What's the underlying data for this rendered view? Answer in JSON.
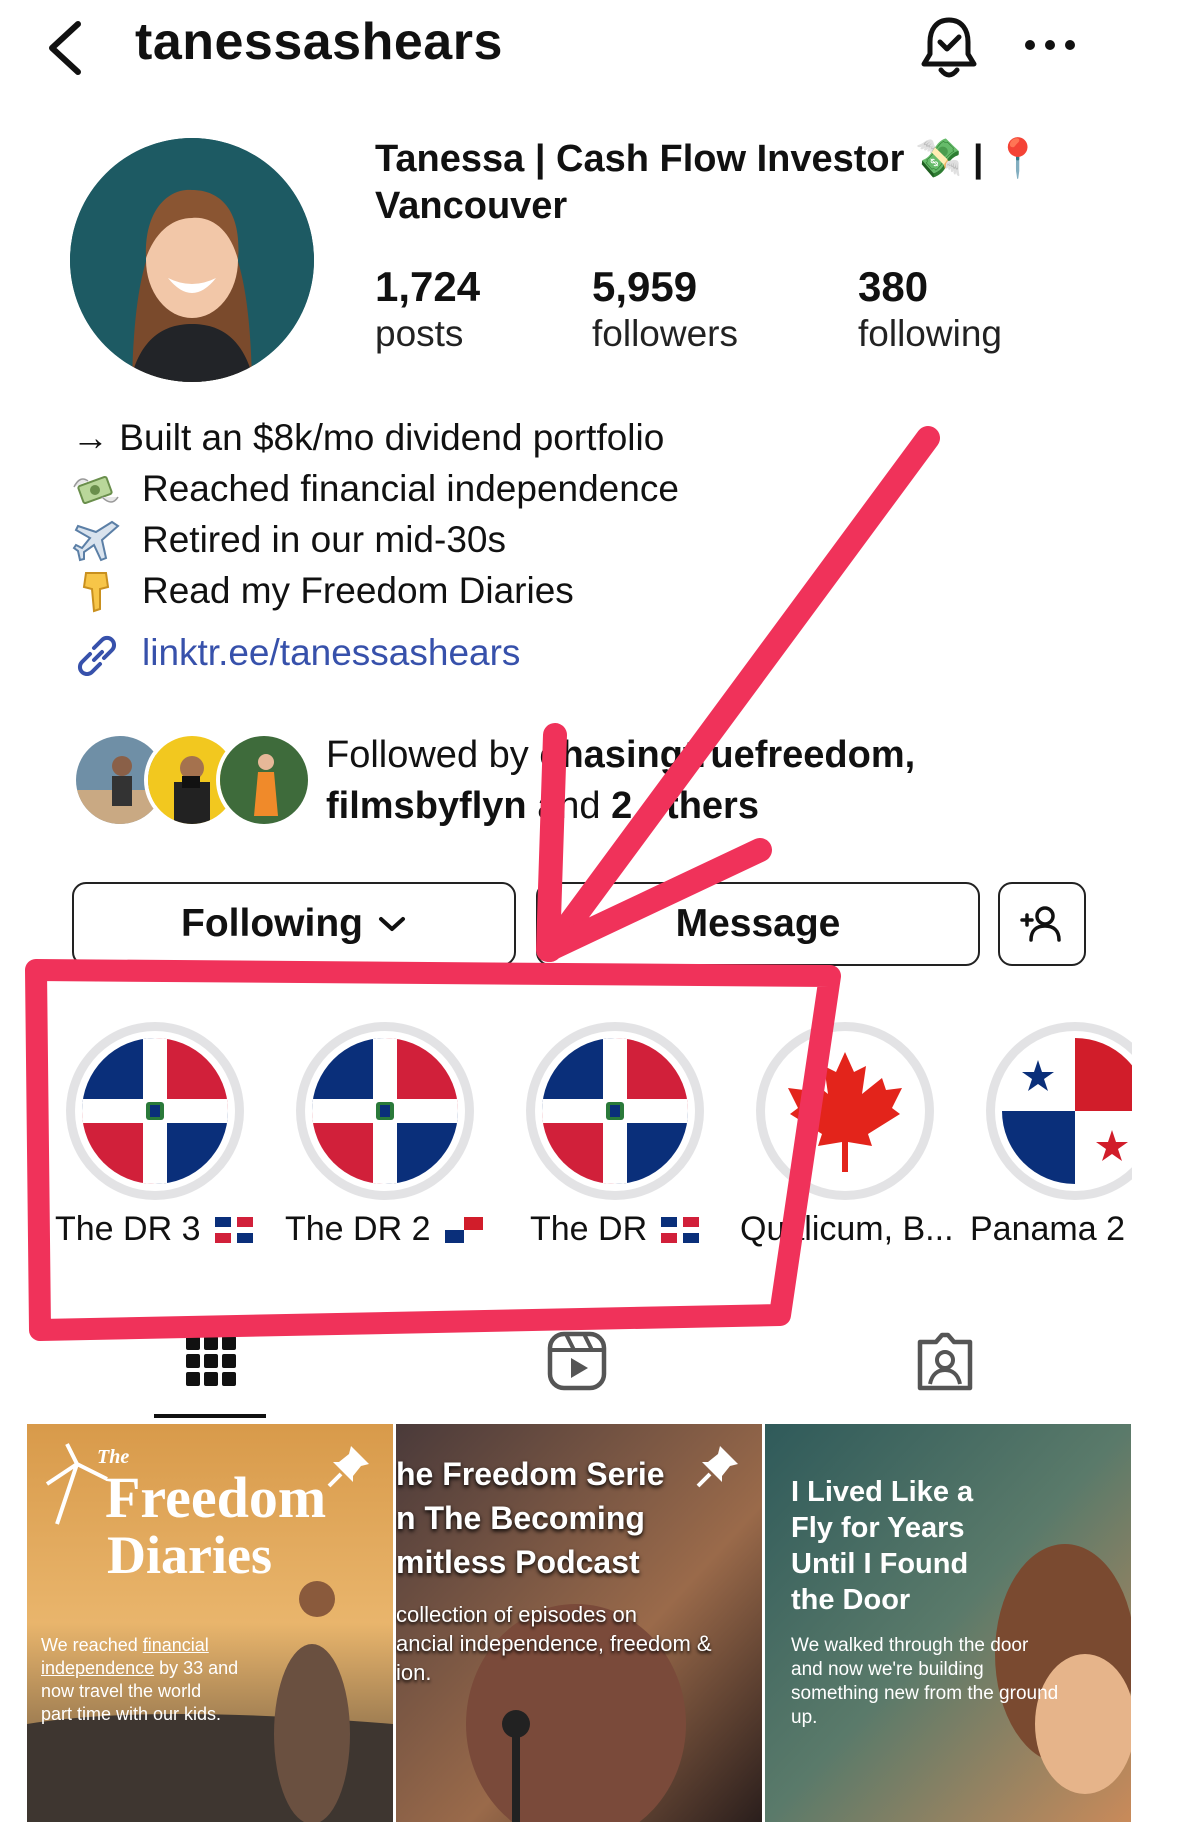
{
  "header": {
    "username": "tanessashears"
  },
  "profile": {
    "display_name": "Tanessa | Cash Flow Investor 💸 | 📍 Vancouver",
    "stats": [
      {
        "value": "1,724",
        "label": "posts"
      },
      {
        "value": "5,959",
        "label": "followers"
      },
      {
        "value": "380",
        "label": "following"
      }
    ],
    "bio": [
      {
        "icon": "arrow-right",
        "text": "→ Built an $8k/mo dividend portfolio"
      },
      {
        "icon": "money-with-wings-emoji",
        "text": "Reached financial independence"
      },
      {
        "icon": "airplane-emoji",
        "text": "Retired in our mid-30s"
      },
      {
        "icon": "pointing-down-emoji",
        "text": "Read my Freedom Diaries"
      }
    ],
    "link": "linktr.ee/tanessashears"
  },
  "followed_by": {
    "prefix": "Followed by ",
    "user1": "chasingtruefreedom,",
    "user2": "filmsbyflyn",
    "middle": " and ",
    "others": "2 others"
  },
  "buttons": {
    "following": "Following",
    "message": "Message"
  },
  "highlights": [
    {
      "label": "The DR 3",
      "flag": "dominican-republic"
    },
    {
      "label": "The DR 2",
      "flag": "dominican-republic"
    },
    {
      "label": "The DR",
      "flag": "dominican-republic"
    },
    {
      "label": "Qualicum, B...",
      "flag": "canada"
    },
    {
      "label": "Panama 2",
      "flag": "panama"
    }
  ],
  "tabs": [
    "grid-icon",
    "reels-icon",
    "tagged-icon"
  ],
  "posts": [
    {
      "title_small": "The",
      "title1": "Freedom",
      "title2": "Diaries",
      "body1": "We reached ",
      "body_link1": "financial",
      "body_link2": "independence",
      "body2": " by 33 and",
      "body3": "now travel the world",
      "body4": "part time with our kids."
    },
    {
      "line1": "he Freedom Serie",
      "line2": "n The Becoming",
      "line3": "mitless Podcast",
      "line4": "collection of episodes on",
      "line5": "ancial independence, freedom &",
      "line6": "ion."
    },
    {
      "line1": "I Lived Like a",
      "line2": "Fly for Years",
      "line3": "Until I Found",
      "line4": "the Door",
      "line5": "We walked through the door",
      "line6": "and now we're building",
      "line7": "something new from the ground",
      "line8": "up."
    }
  ],
  "colors": {
    "annotation": "#f0325a",
    "link": "#3751ab"
  }
}
